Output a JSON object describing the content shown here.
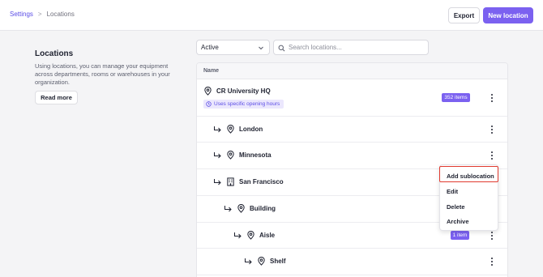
{
  "header": {
    "breadcrumb": {
      "parent": "Settings",
      "current": "Locations",
      "separator": ">"
    },
    "export_label": "Export",
    "new_location_label": "New location",
    "accent_color": "#7b61f0"
  },
  "info": {
    "title": "Locations",
    "description": "Using locations, you can manage your equipment across departments, rooms or warehouses in your organization.",
    "read_more_label": "Read more"
  },
  "filters": {
    "status_value": "Active",
    "search_placeholder": "Search locations..."
  },
  "table": {
    "column_name": "Name",
    "rows": [
      {
        "name": "CR University HQ",
        "icon": "map-pin-icon",
        "badge": "352 items",
        "tag": "Uses specific opening hours"
      },
      {
        "name": "London",
        "icon": "map-pin-icon"
      },
      {
        "name": "Minnesota",
        "icon": "map-pin-icon"
      },
      {
        "name": "San Francisco",
        "icon": "building-icon"
      },
      {
        "name": "Building",
        "icon": "map-pin-icon"
      },
      {
        "name": "Aisle",
        "icon": "map-pin-icon",
        "badge": "1 item"
      },
      {
        "name": "Shelf",
        "icon": "map-pin-icon"
      }
    ]
  },
  "menu": {
    "items": [
      "Add sublocation",
      "Edit",
      "Delete",
      "Archive"
    ],
    "highlight_color": "#e03a2f"
  }
}
